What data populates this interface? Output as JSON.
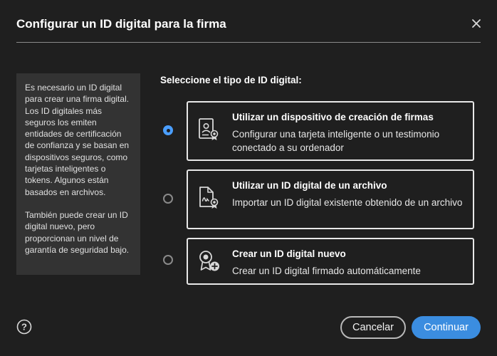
{
  "dialog": {
    "title": "Configurar un ID digital para la firma",
    "close_icon": "close-icon"
  },
  "info": {
    "paragraph1": "Es necesario un ID digital para crear una firma digital. Los ID digitales más seguros los emiten entidades de certificación de confianza y se basan en dispositivos seguros, como tarjetas inteligentes o tokens. Algunos están basados en archivos.",
    "paragraph2": "También puede crear un ID digital nuevo, pero proporcionan un nivel de garantía de seguridad bajo."
  },
  "selection": {
    "label": "Seleccione el tipo de ID digital:",
    "selected_index": 0,
    "options": [
      {
        "title": "Utilizar un dispositivo de creación de firmas",
        "description": "Configurar una tarjeta inteligente o un testimonio conectado a su ordenador",
        "icon": "signature-device-icon"
      },
      {
        "title": "Utilizar un ID digital de un archivo",
        "description": "Importar un ID digital existente obtenido de un archivo",
        "icon": "digital-id-file-icon"
      },
      {
        "title": "Crear un ID digital nuevo",
        "description": "Crear un ID digital firmado automáticamente",
        "icon": "new-digital-id-icon"
      }
    ]
  },
  "footer": {
    "help_icon": "help-icon",
    "cancel_label": "Cancelar",
    "continue_label": "Continuar"
  },
  "colors": {
    "background": "#1f1f1f",
    "panel": "#333333",
    "accent": "#3b8de0",
    "radio_selected": "#4a9eff"
  }
}
